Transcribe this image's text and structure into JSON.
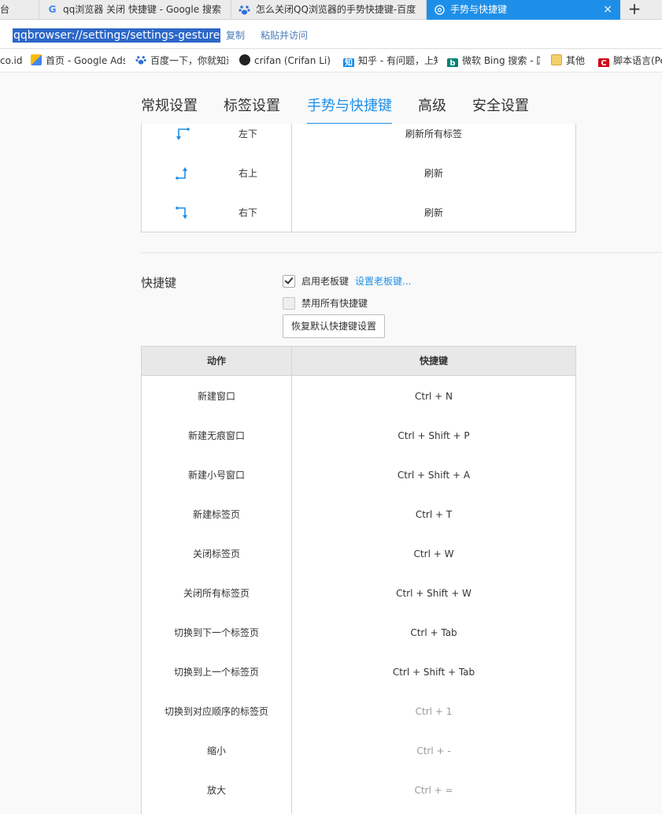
{
  "tabs": [
    {
      "label": "台",
      "icon": ""
    },
    {
      "label": "qq浏览器 关闭 快捷键 - Google 搜索",
      "icon": "google-icon"
    },
    {
      "label": "怎么关闭QQ浏览器的手势快捷键-百度",
      "icon": "baidu-paw-icon"
    },
    {
      "label": "手势与快捷键",
      "icon": "settings-icon",
      "close": "×"
    }
  ],
  "new_tab_symbol": "+",
  "address_bar": {
    "url": "qqbrowser://settings/settings-gesture",
    "copy_label": "复制",
    "paste_go_label": "粘贴并访问"
  },
  "bookmarks": [
    {
      "label": "co.id",
      "icon": ""
    },
    {
      "label": "首页 - Google Ads",
      "icon": "google-ads-icon"
    },
    {
      "label": "百度一下，你就知道",
      "icon": "baidu-paw-icon"
    },
    {
      "label": "crifan (Crifan Li)",
      "icon": "github-icon"
    },
    {
      "label": "知乎 - 有问题，上知乎",
      "icon": "zhihu-icon"
    },
    {
      "label": "微软 Bing 搜索 - 国内版",
      "icon": "bing-icon"
    },
    {
      "label": "其他",
      "icon": "folder-icon"
    },
    {
      "label": "脚本语言(Perl",
      "icon": "crifan-c-icon"
    }
  ],
  "settings_tabs": [
    {
      "label": "常规设置",
      "active": false
    },
    {
      "label": "标签设置",
      "active": false
    },
    {
      "label": "手势与快捷键",
      "active": true
    },
    {
      "label": "高级",
      "active": false
    },
    {
      "label": "安全设置",
      "active": false
    }
  ],
  "gestures": [
    {
      "icon": "gesture-left-down-icon",
      "direction": "左下",
      "action": "刷新所有标签"
    },
    {
      "icon": "gesture-right-up-icon",
      "direction": "右上",
      "action": "刷新"
    },
    {
      "icon": "gesture-right-down-icon",
      "direction": "右下",
      "action": "刷新"
    }
  ],
  "shortcuts_section": {
    "title": "快捷键",
    "boss_key": {
      "label": "启用老板键",
      "checked": true,
      "link": "设置老板键..."
    },
    "disable_all": {
      "label": "禁用所有快捷键",
      "checked": false
    },
    "restore_button": "恢复默认快捷键设置",
    "header_action": "动作",
    "header_key": "快捷键",
    "rows": [
      {
        "action": "新建窗口",
        "key": "Ctrl + N",
        "dim": false
      },
      {
        "action": "新建无痕窗口",
        "key": "Ctrl + Shift + P",
        "dim": false
      },
      {
        "action": "新建小号窗口",
        "key": "Ctrl + Shift + A",
        "dim": false
      },
      {
        "action": "新建标签页",
        "key": "Ctrl + T",
        "dim": false
      },
      {
        "action": "关闭标签页",
        "key": "Ctrl + W",
        "dim": false
      },
      {
        "action": "关闭所有标签页",
        "key": "Ctrl + Shift + W",
        "dim": false
      },
      {
        "action": "切换到下一个标签页",
        "key": "Ctrl + Tab",
        "dim": false
      },
      {
        "action": "切换到上一个标签页",
        "key": "Ctrl + Shift + Tab",
        "dim": false
      },
      {
        "action": "切换到对应顺序的标签页",
        "key": "Ctrl + 1",
        "dim": true
      },
      {
        "action": "缩小",
        "key": "Ctrl + -",
        "dim": true
      },
      {
        "action": "放大",
        "key": "Ctrl + =",
        "dim": true
      }
    ]
  },
  "colors": {
    "accent": "#1e8fe8",
    "url_highlight": "#2c67c8",
    "dim_text": "#9a9a9a"
  }
}
